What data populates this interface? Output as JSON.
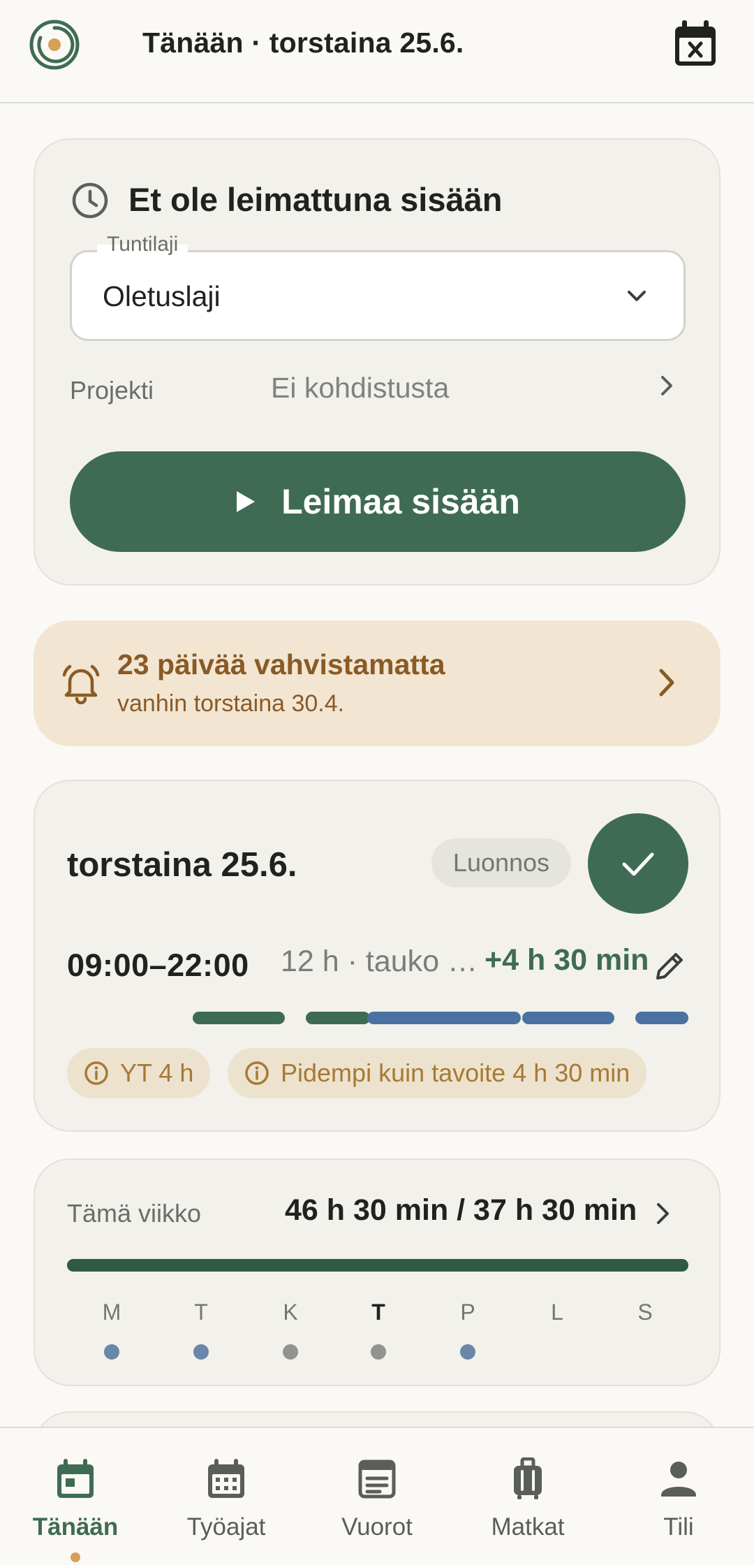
{
  "header": {
    "title": "Tänään · torstaina 25.6.",
    "logo_icon": "ring-logo-icon",
    "calendar_icon": "calendar-x-icon"
  },
  "clock_card": {
    "status_title": "Et ole leimattuna sisään",
    "status_icon": "clock-icon",
    "hour_type_label": "Tuntilaji",
    "hour_type_value": "Oletuslaji",
    "project_label": "Projekti",
    "project_value": "Ei kohdistusta",
    "clock_in_label": "Leimaa sisään"
  },
  "notice": {
    "title": "23 päivää vahvistamatta",
    "subtitle": "vanhin torstaina 30.4.",
    "icon": "bell-icon"
  },
  "day_card": {
    "title": "torstaina 25.6.",
    "status_badge": "Luonnos",
    "time_range": "09:00–22:00",
    "duration": "12 h · tauko …",
    "difference": "+4 h 30 min",
    "timeline_colors": {
      "work": "#3f6b54",
      "other": "#4a72a0"
    },
    "chips": [
      {
        "text": "YT 4 h",
        "icon": "info-icon"
      },
      {
        "text": "Pidempi kuin tavoite 4 h 30 min",
        "icon": "info-icon"
      }
    ]
  },
  "week_card": {
    "label": "Tämä viikko",
    "hours": "46 h 30 min / 37 h 30 min",
    "progress": 1.0,
    "days": [
      {
        "letter": "M",
        "dot": "#6a86a8"
      },
      {
        "letter": "T",
        "dot": "#6a86a8"
      },
      {
        "letter": "K",
        "dot": "#909390"
      },
      {
        "letter": "T",
        "dot": "#909390",
        "today": true
      },
      {
        "letter": "P",
        "dot": "#6a86a8"
      },
      {
        "letter": "L",
        "dot": null
      },
      {
        "letter": "S",
        "dot": null
      }
    ]
  },
  "bottom_nav": {
    "items": [
      {
        "label": "Tänään",
        "icon": "calendar-today-icon",
        "active": true
      },
      {
        "label": "Työajat",
        "icon": "calendar-grid-icon",
        "active": false
      },
      {
        "label": "Vuorot",
        "icon": "shift-list-icon",
        "active": false
      },
      {
        "label": "Matkat",
        "icon": "luggage-icon",
        "active": false
      },
      {
        "label": "Tili",
        "icon": "person-icon",
        "active": false
      }
    ],
    "active_color": "#3f6b54",
    "indicator_color": "#d4a05a"
  }
}
